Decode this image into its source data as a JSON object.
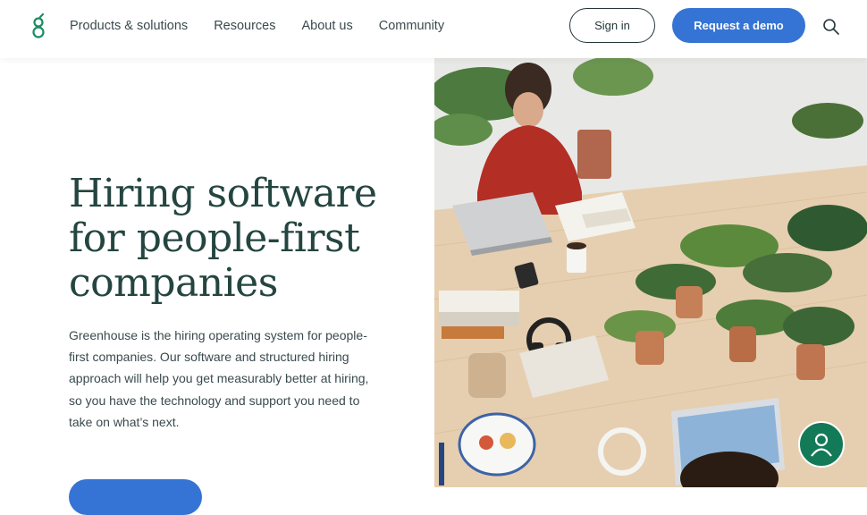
{
  "header": {
    "nav": [
      "Products & solutions",
      "Resources",
      "About us",
      "Community"
    ],
    "signin_label": "Sign in",
    "demo_label": "Request a demo"
  },
  "hero": {
    "title_lines": [
      "Hiring software",
      "for people-first",
      "companies"
    ],
    "description": "Greenhouse is the hiring operating system for people-first companies. Our software and structured hiring approach will help you get measurably better at hiring, so you have the technology and support you need to take on what’s next."
  },
  "colors": {
    "accent": "#3574d4",
    "heading": "#244540",
    "logo": "#1a8c63",
    "chat": "#137a57"
  },
  "icons": {
    "logo": "greenhouse-logo-icon",
    "search": "search-icon",
    "chat": "user-chat-icon"
  }
}
